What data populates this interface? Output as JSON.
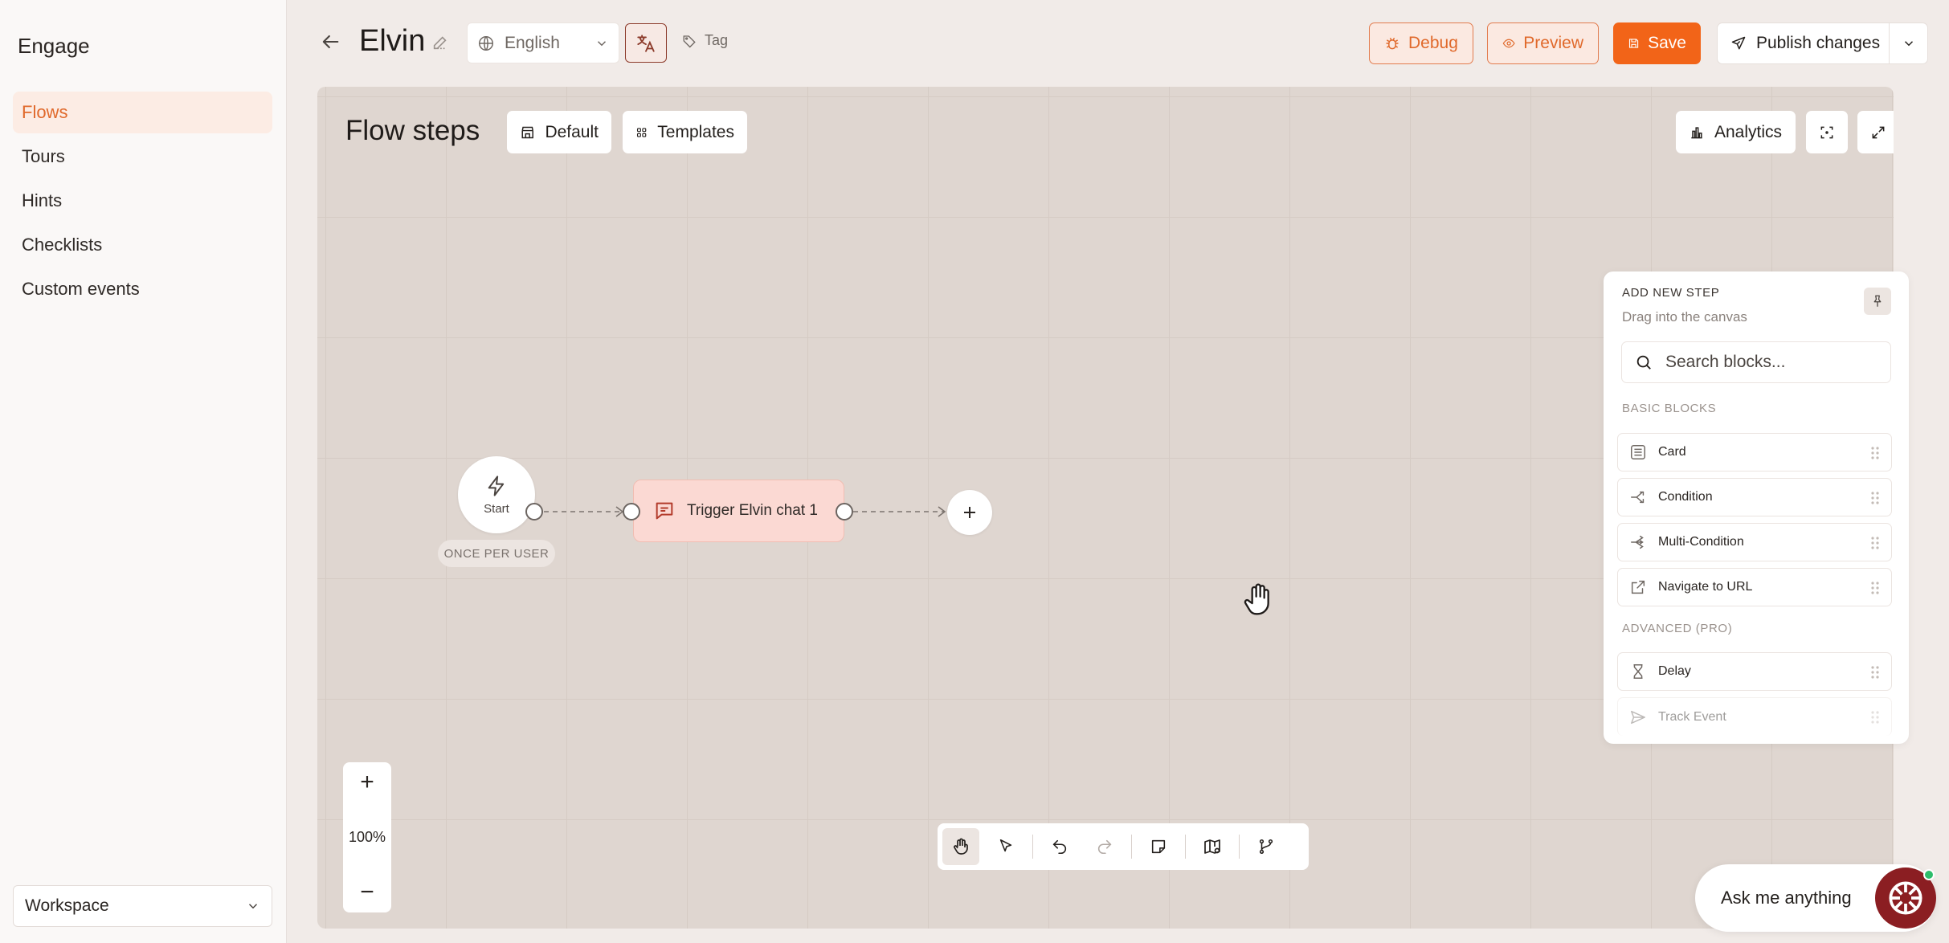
{
  "sidebar": {
    "brand": "Engage",
    "items": [
      {
        "label": "Flows",
        "active": true
      },
      {
        "label": "Tours"
      },
      {
        "label": "Hints"
      },
      {
        "label": "Checklists"
      },
      {
        "label": "Custom events"
      }
    ],
    "workspace": "Workspace"
  },
  "header": {
    "title": "Elvin",
    "language": "English",
    "tag": "Tag",
    "debug": "Debug",
    "preview": "Preview",
    "save": "Save",
    "publish": "Publish changes"
  },
  "canvas": {
    "title": "Flow steps",
    "default_btn": "Default",
    "templates_btn": "Templates",
    "analytics_btn": "Analytics",
    "start_label": "Start",
    "frequency": "ONCE PER USER",
    "trigger_label": "Trigger Elvin chat 1",
    "zoom_in": "+",
    "zoom_level": "100%",
    "zoom_out": "−"
  },
  "panel": {
    "heading": "ADD NEW STEP",
    "subheading": "Drag into the canvas",
    "search_placeholder": "Search blocks...",
    "basic_heading": "BASIC BLOCKS",
    "basic": [
      "Card",
      "Condition",
      "Multi-Condition",
      "Navigate to URL"
    ],
    "advanced_heading": "ADVANCED (PRO)",
    "advanced": [
      "Delay",
      "Track Event"
    ]
  },
  "assistant": {
    "label": "Ask me anything"
  },
  "colors": {
    "accent": "#f26418",
    "accent_soft": "#fbe9e1",
    "trigger_bg": "#fbd9d3",
    "canvas_bg": "#dfd6d0"
  }
}
